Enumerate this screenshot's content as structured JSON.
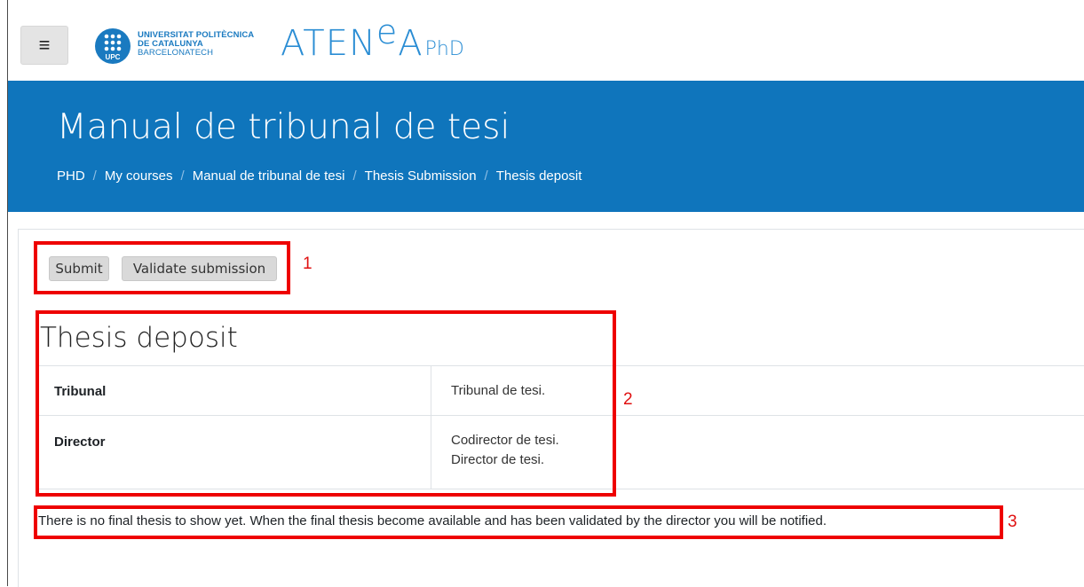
{
  "brand": {
    "university_lines": [
      "UNIVERSITAT POLITÈCNICA",
      "DE CATALUNYA",
      "BARCELONATECH"
    ],
    "logo_badge": "UPC",
    "app_name_prefix": "ATEN",
    "app_name_sup": "e",
    "app_name_mid": "A",
    "app_name_suffix": "PhD",
    "accent_color": "#0f75bc"
  },
  "navbar": {
    "menu_icon": "hamburger-icon",
    "menu_glyph": "≡"
  },
  "header": {
    "title": "Manual de tribunal de tesi",
    "breadcrumb": [
      "PHD",
      "My courses",
      "Manual de tribunal de tesi",
      "Thesis Submission",
      "Thesis deposit"
    ],
    "separator": "/"
  },
  "actions": {
    "submit_label": "Submit",
    "validate_label": "Validate submission"
  },
  "section": {
    "title": "Thesis deposit",
    "rows": [
      {
        "label": "Tribunal",
        "values": [
          "Tribunal de tesi."
        ]
      },
      {
        "label": "Director",
        "values": [
          "Codirector de tesi.",
          "Director de tesi."
        ]
      }
    ]
  },
  "notice": "There is no final thesis to show yet. When the final thesis become available and has been validated by the director you will be notified.",
  "annotations": {
    "labels": [
      "1",
      "2",
      "3"
    ],
    "color": "#ee0000"
  }
}
